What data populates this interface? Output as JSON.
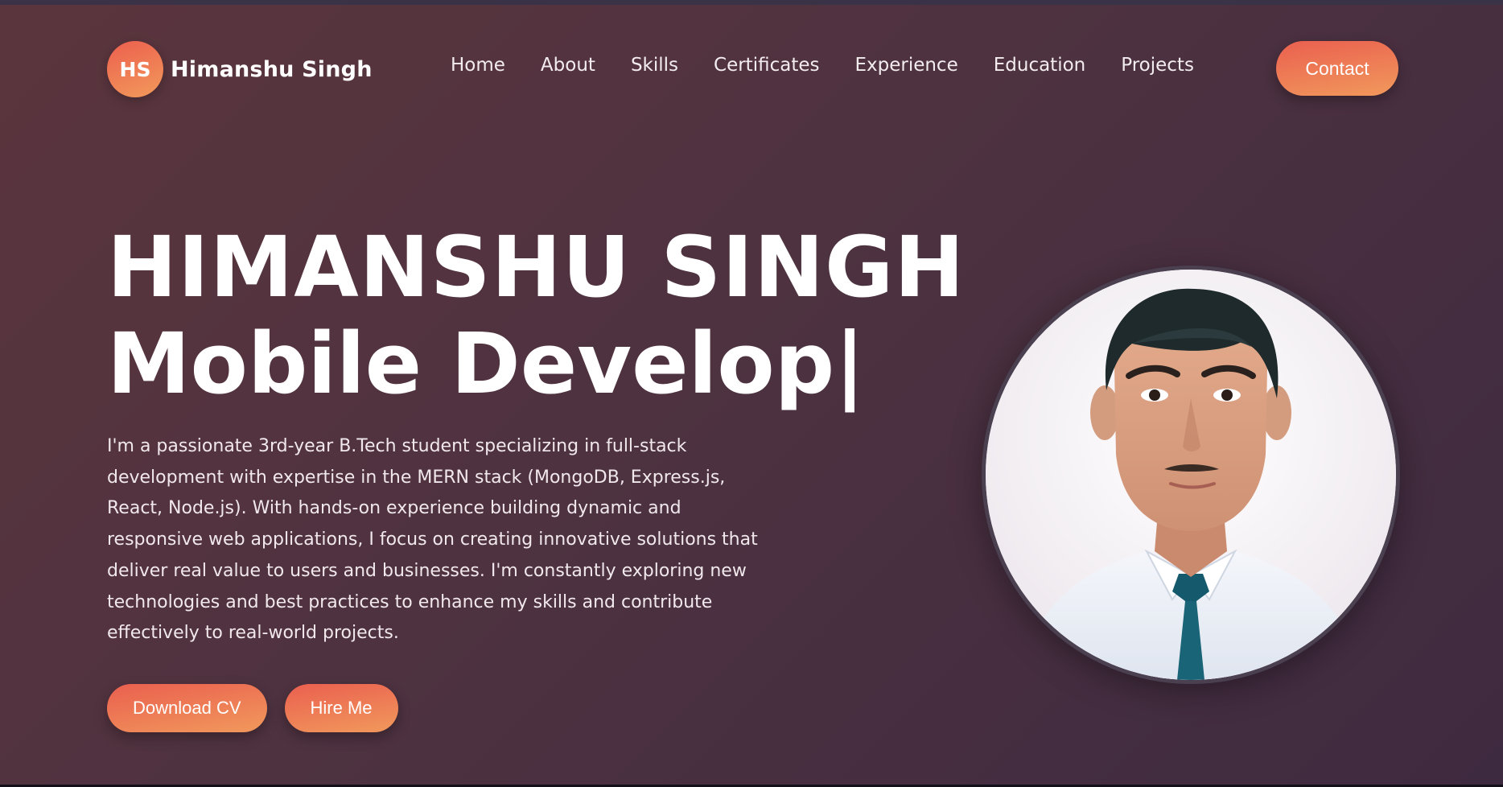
{
  "logo": {
    "initials": "HS",
    "name": "Himanshu Singh"
  },
  "nav": {
    "items": [
      {
        "label": "Home"
      },
      {
        "label": "About"
      },
      {
        "label": "Skills"
      },
      {
        "label": "Certificates"
      },
      {
        "label": "Experience"
      },
      {
        "label": "Education"
      },
      {
        "label": "Projects"
      }
    ],
    "contact_label": "Contact"
  },
  "hero": {
    "name": "HIMANSHU SINGH",
    "role_typed": "Mobile Develop|",
    "description": "I'm a passionate 3rd-year B.Tech student specializing in full-stack development with expertise in the MERN stack (MongoDB, Express.js, React, Node.js). With hands-on experience building dynamic and responsive web applications, I focus on creating innovative solutions that deliver real value to users and businesses. I'm constantly exploring new technologies and best practices to enhance my skills and contribute effectively to real-world projects.",
    "buttons": {
      "download_cv": "Download CV",
      "hire_me": "Hire Me"
    }
  },
  "profile_photo": {
    "icon": "profile-photo"
  },
  "colors": {
    "accent_start": "#ea5f4f",
    "accent_end": "#f1995c",
    "background_start": "#5b353d",
    "background_end": "#3e2a40"
  }
}
